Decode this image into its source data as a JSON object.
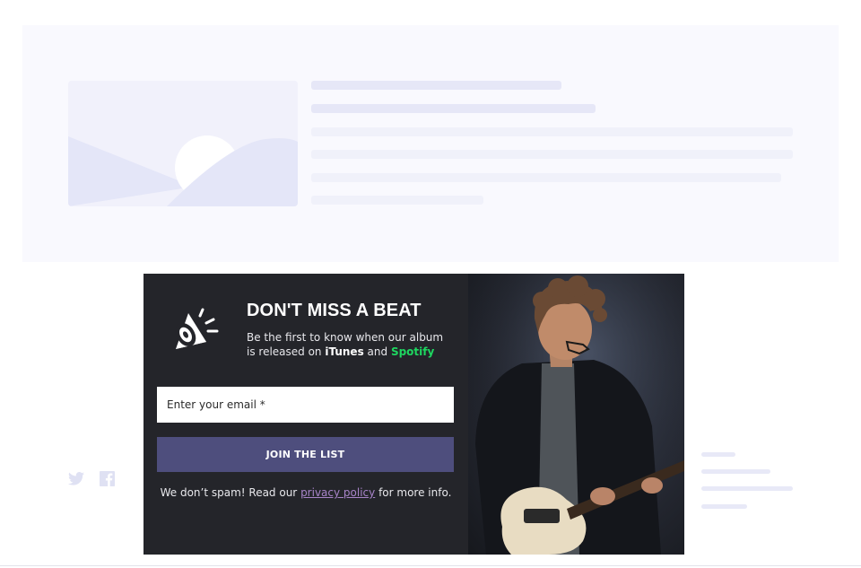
{
  "modal": {
    "title": "DON'T MISS A BEAT",
    "desc_prefix": "Be the first to know when our album is released on ",
    "desc_itunes": "iTunes",
    "desc_and": " and ",
    "desc_spotify": "Spotify",
    "email_placeholder": "Enter your email *",
    "email_value": "",
    "join_label": "JOIN THE LIST",
    "spam_prefix": "We don’t spam! Read our ",
    "privacy_link": "privacy policy",
    "spam_suffix": " for more info."
  },
  "icons": {
    "speaker": "speaker-icon",
    "social": [
      "twitter-icon",
      "facebook-icon"
    ]
  },
  "colors": {
    "modal_bg": "#24252a",
    "button_bg": "#4e4e7d",
    "spotify": "#1ed760",
    "link": "#a884c9",
    "placeholder_dark": "#e6e7f7",
    "placeholder_light": "#f0f1fa"
  }
}
